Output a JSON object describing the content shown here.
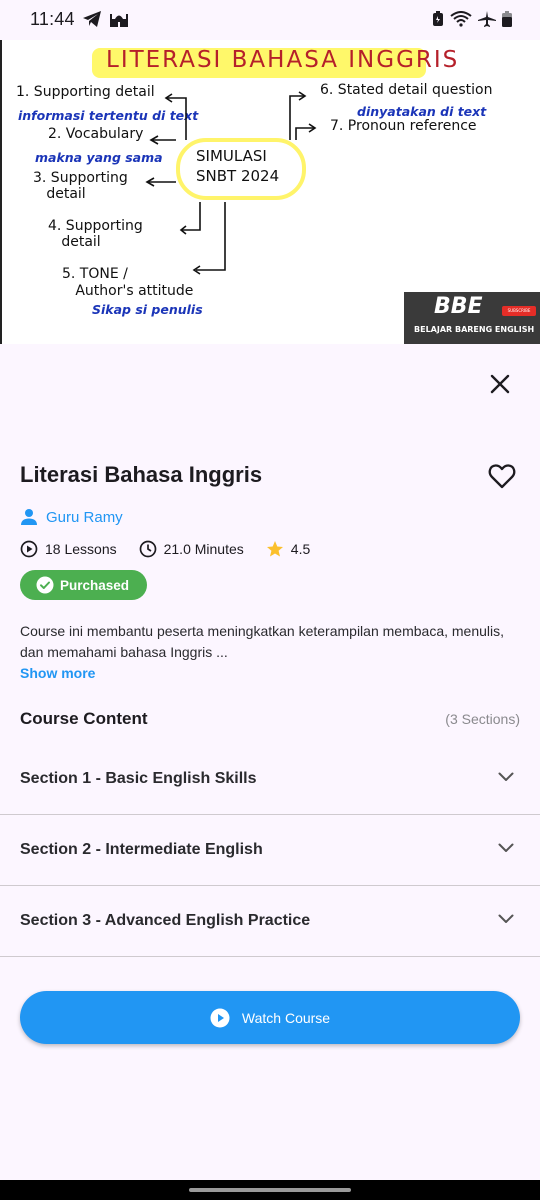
{
  "status_bar": {
    "time": "11:44",
    "left_icons": [
      "telegram-icon",
      "mosque-icon"
    ],
    "right_icons": [
      "battery-saver-icon",
      "wifi-icon",
      "airplane-icon",
      "battery-icon"
    ]
  },
  "thumbnail": {
    "title": "LITERASI BAHASA INGGRIS",
    "center_line1": "SIMULASI",
    "center_line2": "SNBT 2024",
    "items": [
      {
        "text": "1. Supporting detail",
        "note": "informasi tertentu di text"
      },
      {
        "text": "2. Vocabulary",
        "note": "makna yang sama"
      },
      {
        "text": "3. Supporting\n   detail",
        "note": ""
      },
      {
        "text": "4. Supporting\n   detail",
        "note": ""
      },
      {
        "text": "5. TONE /\n   Author's attitude",
        "note": "Sikap si penulis"
      },
      {
        "text": "6. Stated detail question",
        "note": "dinyatakan di text"
      },
      {
        "text": "7. Pronoun reference",
        "note": ""
      }
    ],
    "logo_text": "BBE",
    "logo_subtitle": "BELAJAR BARENG ENGLISH",
    "subscribe_label": "SUBSCRIBE"
  },
  "course": {
    "title": "Literasi Bahasa Inggris",
    "author": "Guru Ramy",
    "lessons": "18 Lessons",
    "duration": "21.0 Minutes",
    "rating": "4.5",
    "badge": "Purchased",
    "description": "Course ini membantu peserta meningkatkan keterampilan membaca, menulis, dan memahami bahasa Inggris ...",
    "show_more": "Show more"
  },
  "content": {
    "heading": "Course Content",
    "count": "(3 Sections)",
    "sections": [
      {
        "label": "Section 1 - Basic English Skills"
      },
      {
        "label": "Section 2 - Intermediate English"
      },
      {
        "label": "Section 3 - Advanced English Practice"
      }
    ]
  },
  "actions": {
    "watch_label": "Watch Course"
  },
  "colors": {
    "accent": "#2196f3",
    "badge_green": "#4caf50",
    "background": "#fcf6ff",
    "star": "#fbc02d"
  }
}
